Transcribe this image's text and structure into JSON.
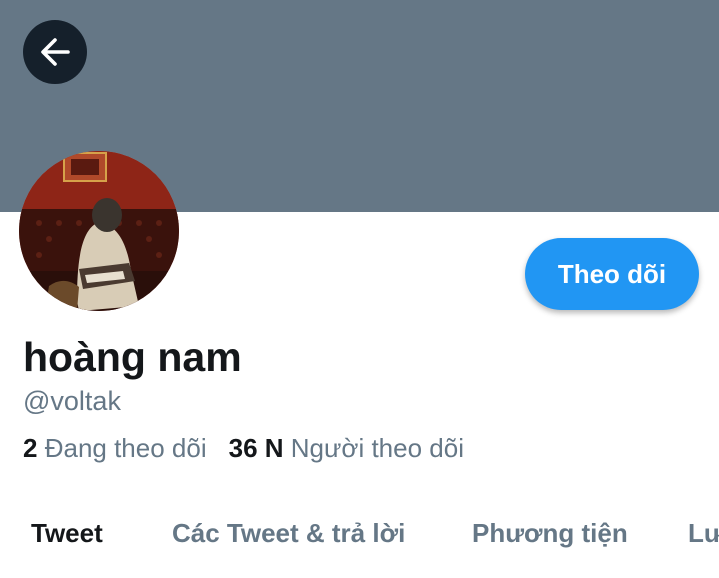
{
  "header": {
    "back_icon": "arrow-left-icon",
    "banner_color": "#657786"
  },
  "profile": {
    "display_name": "hoàng nam",
    "handle": "@voltak",
    "follow_label": "Theo dõi",
    "accent_color": "#2196f3"
  },
  "stats": {
    "following_count": "2",
    "following_label": "Đang theo dõi",
    "followers_count": "36 N",
    "followers_label": "Người theo dõi"
  },
  "tabs": [
    {
      "label": "Tweet",
      "active": true
    },
    {
      "label": "Các Tweet & trả lời",
      "active": false
    },
    {
      "label": "Phương tiện",
      "active": false
    },
    {
      "label": "Lư",
      "active": false
    }
  ]
}
